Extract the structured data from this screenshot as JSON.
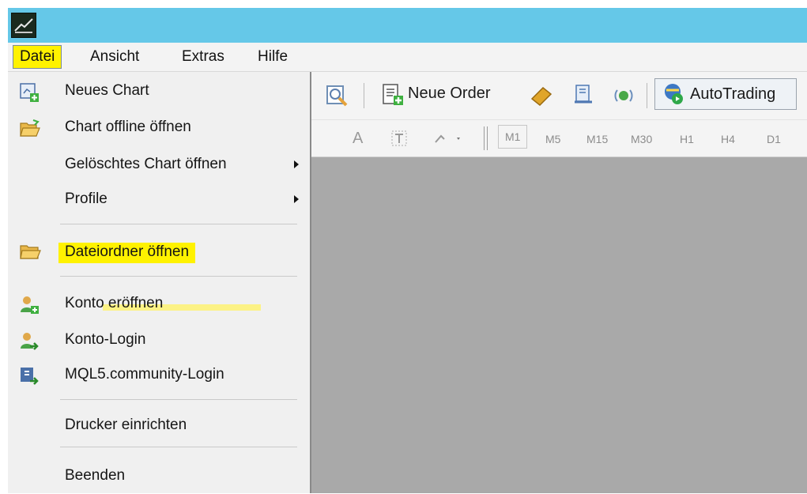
{
  "menubar": {
    "items": [
      "Datei",
      "Ansicht",
      "Extras",
      "Hilfe"
    ]
  },
  "toolbar": {
    "new_order_label": "Neue Order",
    "autotrading_label": "AutoTrading",
    "timeframes": [
      "M1",
      "M5",
      "M15",
      "M30",
      "H1",
      "H4",
      "D1"
    ],
    "text_tool_label": "A"
  },
  "datei_menu": {
    "items": [
      {
        "label": "Neues Chart",
        "icon": "new-chart-icon"
      },
      {
        "label": "Chart offline öffnen",
        "icon": "open-folder-icon"
      },
      {
        "label": "Gelöschtes Chart öffnen",
        "submenu": true
      },
      {
        "label": "Profile",
        "submenu": true
      },
      {
        "label": "Dateiordner öffnen",
        "icon": "folder-icon",
        "highlighted": true
      },
      {
        "label": "Konto eröffnen",
        "icon": "user-add-icon"
      },
      {
        "label": "Konto-Login",
        "icon": "user-login-icon"
      },
      {
        "label": "MQL5.community-Login",
        "icon": "mql5-login-icon"
      },
      {
        "label": "Drucker einrichten"
      },
      {
        "label": "Beenden"
      }
    ]
  },
  "colors": {
    "titlebar": "#65c8e8",
    "highlight": "#fff200",
    "chart_background": "#a9a9a9"
  }
}
